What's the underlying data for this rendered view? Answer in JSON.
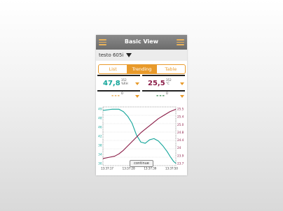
{
  "header": {
    "title": "Basic View",
    "menu_left_icon": "list-menu-icon",
    "menu_right_icon": "hamburger-menu-icon"
  },
  "device": {
    "name": "testo 605i"
  },
  "tabs": [
    {
      "label": "List"
    },
    {
      "label": "Trending",
      "active": true
    },
    {
      "label": "Table"
    }
  ],
  "tiles": {
    "humidity": {
      "value": "47,8",
      "sup": "352",
      "unit": "%RH",
      "color": "#13a59a"
    },
    "temperature": {
      "value": "25,5",
      "sup": "352",
      "unit": "°C",
      "color": "#8a1b46"
    },
    "empty1": {
      "value": "---",
      "sup": "0",
      "color": "#e89a2b"
    },
    "empty2": {
      "value": "---",
      "sup": "0",
      "color": "#1f7a3a"
    }
  },
  "continue_label": "continue",
  "chart_data": {
    "type": "line",
    "x": [
      "13:37:17",
      "13:37:28",
      "13:37:39",
      "13:37:50"
    ],
    "left_axis": {
      "ticks": [
        "49",
        "48",
        "46",
        "42",
        "38",
        "34",
        "30"
      ],
      "color": "#13a59a"
    },
    "right_axis": {
      "ticks": [
        "25.5",
        "25.4",
        "25.0",
        "24.8",
        "24.4",
        "24",
        "23.9",
        "23.7"
      ],
      "color": "#8a1b46"
    },
    "series": [
      {
        "axis": "left",
        "color": "#13a59a",
        "points": [
          [
            0,
            0.06
          ],
          [
            0.12,
            0.04
          ],
          [
            0.22,
            0.04
          ],
          [
            0.28,
            0.08
          ],
          [
            0.34,
            0.16
          ],
          [
            0.4,
            0.28
          ],
          [
            0.46,
            0.48
          ],
          [
            0.52,
            0.6
          ],
          [
            0.58,
            0.62
          ],
          [
            0.64,
            0.56
          ],
          [
            0.7,
            0.54
          ],
          [
            0.76,
            0.58
          ],
          [
            0.82,
            0.66
          ],
          [
            0.88,
            0.76
          ],
          [
            0.93,
            0.86
          ],
          [
            0.97,
            0.93
          ],
          [
            1,
            0.96
          ]
        ]
      },
      {
        "axis": "right",
        "color": "#8a1b46",
        "points": [
          [
            0,
            0.88
          ],
          [
            0.08,
            0.86
          ],
          [
            0.16,
            0.84
          ],
          [
            0.22,
            0.8
          ],
          [
            0.28,
            0.74
          ],
          [
            0.36,
            0.64
          ],
          [
            0.44,
            0.54
          ],
          [
            0.52,
            0.44
          ],
          [
            0.6,
            0.36
          ],
          [
            0.68,
            0.28
          ],
          [
            0.76,
            0.2
          ],
          [
            0.84,
            0.14
          ],
          [
            0.92,
            0.08
          ],
          [
            1,
            0.04
          ]
        ]
      }
    ]
  }
}
